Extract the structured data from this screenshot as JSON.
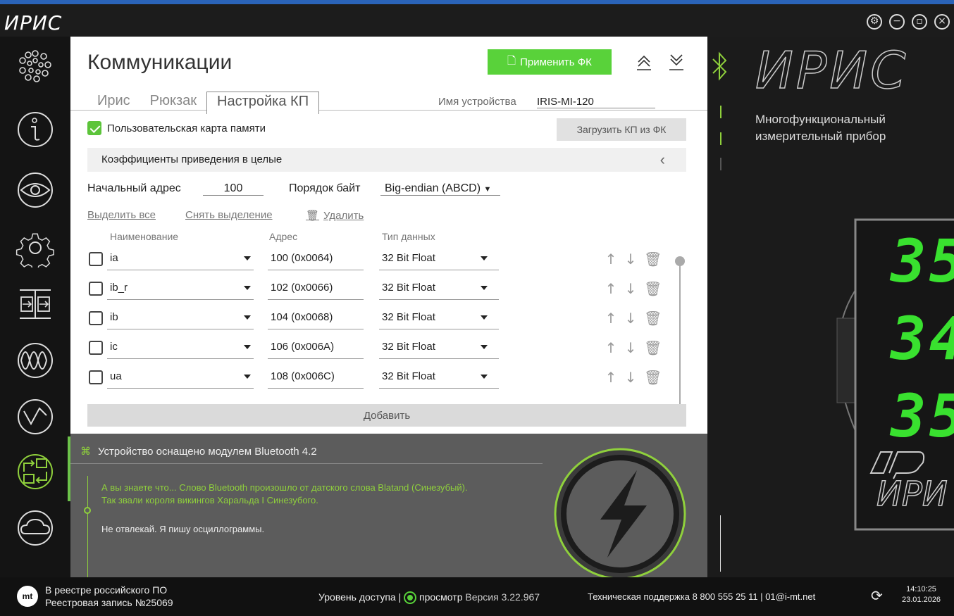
{
  "app": {
    "logo_text": "ИРИС",
    "window_controls": [
      "settings-icon",
      "minimize-icon",
      "maximize-icon",
      "close-icon"
    ]
  },
  "sidebar": {
    "items": [
      {
        "name": "sidebar-item-home",
        "icon": "dots-flower-icon"
      },
      {
        "name": "sidebar-item-info",
        "icon": "info-icon"
      },
      {
        "name": "sidebar-item-view",
        "icon": "eye-icon"
      },
      {
        "name": "sidebar-item-settings",
        "icon": "gear-icon"
      },
      {
        "name": "sidebar-item-io",
        "icon": "io-arrows-icon"
      },
      {
        "name": "sidebar-item-oscillograms",
        "icon": "sine-wave-icon"
      },
      {
        "name": "sidebar-item-analysis",
        "icon": "wave-circle-icon"
      },
      {
        "name": "sidebar-item-communications",
        "icon": "exchange-icon",
        "active": true
      },
      {
        "name": "sidebar-item-cloud",
        "icon": "cloud-icon"
      }
    ],
    "accent_color": "#6cc24a"
  },
  "main": {
    "title": "Коммуникации",
    "apply_label": "Применить ФК",
    "tabs": [
      {
        "label": "Ирис"
      },
      {
        "label": "Рюкзак"
      },
      {
        "label": "Настройка КП"
      }
    ],
    "device_label": "Имя устройства",
    "device_name": "IRIS-MI-120",
    "custom_map_label": "Пользовательская карта памяти",
    "custom_map_checked": true,
    "load_button": "Загрузить КП из ФК",
    "coef_section": "Коэффициенты приведения в целые",
    "start_address_label": "Начальный адрес",
    "start_address_value": "100",
    "byte_order_label": "Порядок байт",
    "byte_order_value": "Big-endian (ABCD)",
    "select_all": "Выделить все",
    "deselect": "Снять выделение",
    "delete": "Удалить",
    "columns": {
      "name": "Наименование",
      "address": "Адрес",
      "type": "Тип данных"
    },
    "rows": [
      {
        "name": "ia",
        "address": "100 (0x0064)",
        "type": "32 Bit Float"
      },
      {
        "name": "ib_r",
        "address": "102 (0x0066)",
        "type": "32 Bit Float"
      },
      {
        "name": "ib",
        "address": "104 (0x0068)",
        "type": "32 Bit Float"
      },
      {
        "name": "ic",
        "address": "106 (0x006A)",
        "type": "32 Bit Float"
      },
      {
        "name": "ua",
        "address": "108 (0x006C)",
        "type": "32 Bit Float"
      }
    ],
    "add_label": "Добавить",
    "accent_color": "#59d23a"
  },
  "info": {
    "bluetooth_title": "Устройство оснащено модулем Bluetooth 4.2",
    "tip_line1": "А вы знаете что... Слово Bluetooth произошло от датского слова Blatand (Синезубый).",
    "tip_line2": "Так звали короля викингов Харальда I Синезубого.",
    "joke": "Не отвлекай. Я пишу осциллограммы."
  },
  "right": {
    "brand": "ИРИС",
    "description": "Многофункциональный измерительный прибор",
    "device_digits": [
      "35",
      "34",
      "35"
    ],
    "device_brand": "ИРИ",
    "digit_color": "#39e12f"
  },
  "statusbar": {
    "logo": "mt",
    "registry_line1": "В реестре российского ПО",
    "registry_line2": "Реестровая запись №25069",
    "access_label": "Уровень доступа |",
    "access_value": "просмотр",
    "version": "Версия 3.22.967",
    "support": "Техническая поддержка  8 800 555 25 11 | 01@i-mt.net",
    "time": "14:10:25",
    "date": "23.01.2026"
  }
}
